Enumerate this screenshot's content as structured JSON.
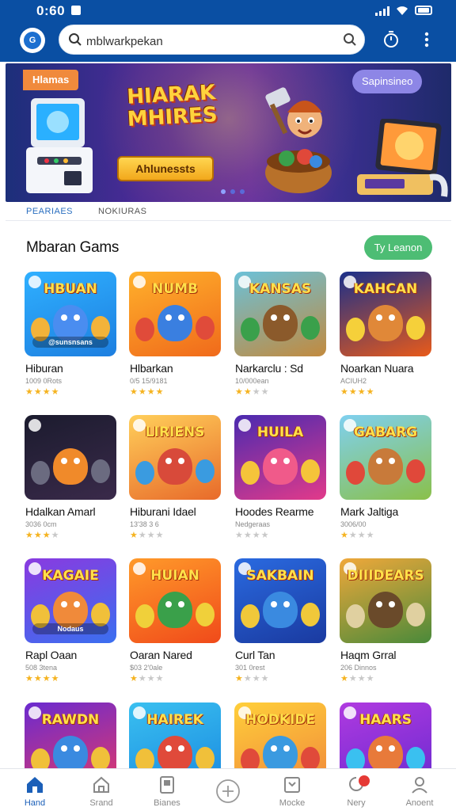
{
  "status_bar": {
    "time": "0:60"
  },
  "header": {
    "logo_text": "G",
    "search": {
      "value": "mblwarkpekan",
      "placeholder": ""
    }
  },
  "banner": {
    "tag_left": "Hlamas",
    "tag_right": "Sapinsineo",
    "logo_title": "HIARAK MHIRES",
    "cta_label": "Ahlunessts"
  },
  "tabs": [
    {
      "label": "PEARIAES",
      "active": true
    },
    {
      "label": "NOKIURAS",
      "active": false
    }
  ],
  "section": {
    "title": "Mbaran Gams",
    "view_all_label": "Ty Leanon"
  },
  "games": [
    {
      "name": "Hiburan",
      "meta": "1009 0Rots",
      "rating": 4,
      "logo": "HBUAN",
      "sub": "@sunsnsans",
      "bg": [
        "#2fb0ff",
        "#1d7fe0"
      ],
      "char": "#4a8df0",
      "side": "#f2b33a"
    },
    {
      "name": "Hlbarkan",
      "meta": "0/5 15/9181",
      "rating": 4,
      "logo": "NUMB",
      "sub": "",
      "bg": [
        "#ffb12b",
        "#f06a1b"
      ],
      "char": "#3a7fe0",
      "side": "#e04b3a"
    },
    {
      "name": "Narkarclu : Sd",
      "meta": "10/000ean",
      "rating": 2,
      "logo": "KANSAS",
      "sub": "",
      "bg": [
        "#6bc1d8",
        "#c28a3e"
      ],
      "char": "#8b5a2b",
      "side": "#3aa04b"
    },
    {
      "name": "Noarkan Nuara",
      "meta": "ACIUH2",
      "rating": 4,
      "logo": "KAHCAN",
      "sub": "",
      "bg": [
        "#1a2f8a",
        "#e85a1a"
      ],
      "char": "#e08838",
      "side": "#f5d03a"
    },
    {
      "name": "Hdalkan Amarl",
      "meta": "3036 0cm",
      "rating": 3,
      "logo": "",
      "sub": "",
      "bg": [
        "#1b1b2e",
        "#3a2a4a"
      ],
      "char": "#f08a2a",
      "side": "#6b6b80"
    },
    {
      "name": "Hiburani Idael",
      "meta": "13'38 3 6",
      "rating": 1,
      "logo": "LIRIENS",
      "sub": "",
      "bg": [
        "#ffcf5a",
        "#e86a2a"
      ],
      "char": "#d84a3a",
      "side": "#3a9be0"
    },
    {
      "name": "Hoodes Rearme",
      "meta": "Nedgeraas",
      "rating": 0,
      "logo": "HUILA",
      "sub": "",
      "bg": [
        "#4a2ab0",
        "#e23a8a"
      ],
      "char": "#f05a8a",
      "side": "#f5c43a"
    },
    {
      "name": "Mark Jaltiga",
      "meta": "3006/00",
      "rating": 1,
      "logo": "GABARG",
      "sub": "",
      "bg": [
        "#7fd0f0",
        "#8ac04a"
      ],
      "char": "#c87a3a",
      "side": "#e0483a"
    },
    {
      "name": "Rapl Oaan",
      "meta": "508 3tena",
      "rating": 4,
      "logo": "KAGAIE",
      "sub": "Nodaus",
      "bg": [
        "#8a3ae0",
        "#3a6ff0"
      ],
      "char": "#f08a3a",
      "side": "#f0c03a"
    },
    {
      "name": "Oaran Nared",
      "meta": "$03 2'0ale",
      "rating": 1,
      "logo": "HUIAN",
      "sub": "",
      "bg": [
        "#ff9a2a",
        "#f04a1a"
      ],
      "char": "#3aa04a",
      "side": "#f0d03a"
    },
    {
      "name": "Curl Tan",
      "meta": "301 0rest",
      "rating": 1,
      "logo": "SAKBAIN",
      "sub": "",
      "bg": [
        "#2a6ae0",
        "#1a3aa0"
      ],
      "char": "#3a8ae0",
      "side": "#f0c83a"
    },
    {
      "name": "Haqm Grral",
      "meta": "206 Dinnos",
      "rating": 1,
      "logo": "DIIIDEARS",
      "sub": "",
      "bg": [
        "#f0a83a",
        "#4a8a3a"
      ],
      "char": "#6a4a2a",
      "side": "#e0d0a0"
    },
    {
      "name": "",
      "meta": "",
      "rating": 0,
      "logo": "RAWDN",
      "sub": "",
      "bg": [
        "#6a2ad0",
        "#e03a6a"
      ],
      "char": "#3a8ae0",
      "side": "#f0c03a"
    },
    {
      "name": "",
      "meta": "",
      "rating": 0,
      "logo": "HAIREK",
      "sub": "",
      "bg": [
        "#3ac0f0",
        "#1a8ae0"
      ],
      "char": "#e04a3a",
      "side": "#f0c03a"
    },
    {
      "name": "",
      "meta": "",
      "rating": 0,
      "logo": "HODKIDE",
      "sub": "",
      "bg": [
        "#ffcf3a",
        "#f0883a"
      ],
      "char": "#3a9ae0",
      "side": "#e04a3a"
    },
    {
      "name": "",
      "meta": "",
      "rating": 0,
      "logo": "HAARS",
      "sub": "",
      "bg": [
        "#b03ae0",
        "#6a2ad0"
      ],
      "char": "#e87a3a",
      "side": "#3ac0f0"
    }
  ],
  "bottom_nav": [
    {
      "label": "Hand",
      "icon": "home-icon",
      "active": true
    },
    {
      "label": "Srand",
      "icon": "store-icon",
      "active": false
    },
    {
      "label": "Bianes",
      "icon": "library-icon",
      "active": false
    },
    {
      "label": "",
      "icon": "add-icon",
      "active": false
    },
    {
      "label": "Mocke",
      "icon": "chat-icon",
      "active": false
    },
    {
      "label": "Nery",
      "icon": "notifications-icon",
      "active": false
    },
    {
      "label": "Anoent",
      "icon": "profile-icon",
      "active": false
    }
  ],
  "colors": {
    "header": "#0a4fa3",
    "accent": "#2a6fc0",
    "view_all": "#4dbd74",
    "star": "#f5b320"
  }
}
